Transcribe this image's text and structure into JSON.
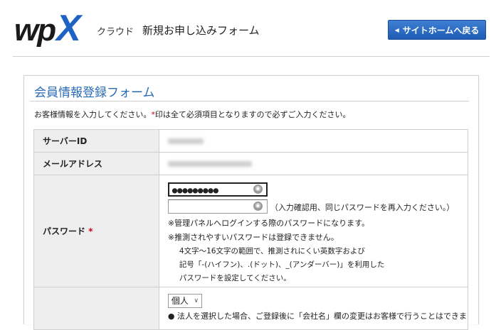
{
  "header": {
    "logo": {
      "wp": "wp",
      "x": "X"
    },
    "service": "クラウド",
    "title": "新規お申し込みフォーム",
    "back_button": "サイトホームへ戻る",
    "colors": {
      "brand_blue": "#1e63c4",
      "button_blue": "#2f6fc9"
    }
  },
  "form": {
    "title": "会員情報登録フォーム",
    "notice_before": "お客様情報を入力してください。",
    "notice_mark": "*",
    "notice_after": "印は全て必須項目となりますので必ずご入力ください。",
    "rows": {
      "server_id": {
        "label": "サーバーID"
      },
      "email": {
        "label": "メールアドレス"
      },
      "password": {
        "label": "パスワード",
        "required_mark": "*",
        "value_masked": "●●●●●●●●●",
        "confirm_hint": "（入力確認用、同じパスワードを再入力ください。）",
        "note1": "※管理パネルへログインする際のパスワードになります。",
        "note2": "※推測されやすいパスワードは登録できません。",
        "rule1": "4文字～16文字の範囲で、推測されにくい英数字および",
        "rule2": "記号「-(ハイフン)、.(ドット)、_(アンダーバー)」を利用した",
        "rule3": "パスワードを設定してください。"
      },
      "type": {
        "selected": "個人",
        "bullet_note": "● 法人を選択した場合、ご登録後に「会社名」欄の変更はお客様で行うことはできま"
      }
    }
  }
}
